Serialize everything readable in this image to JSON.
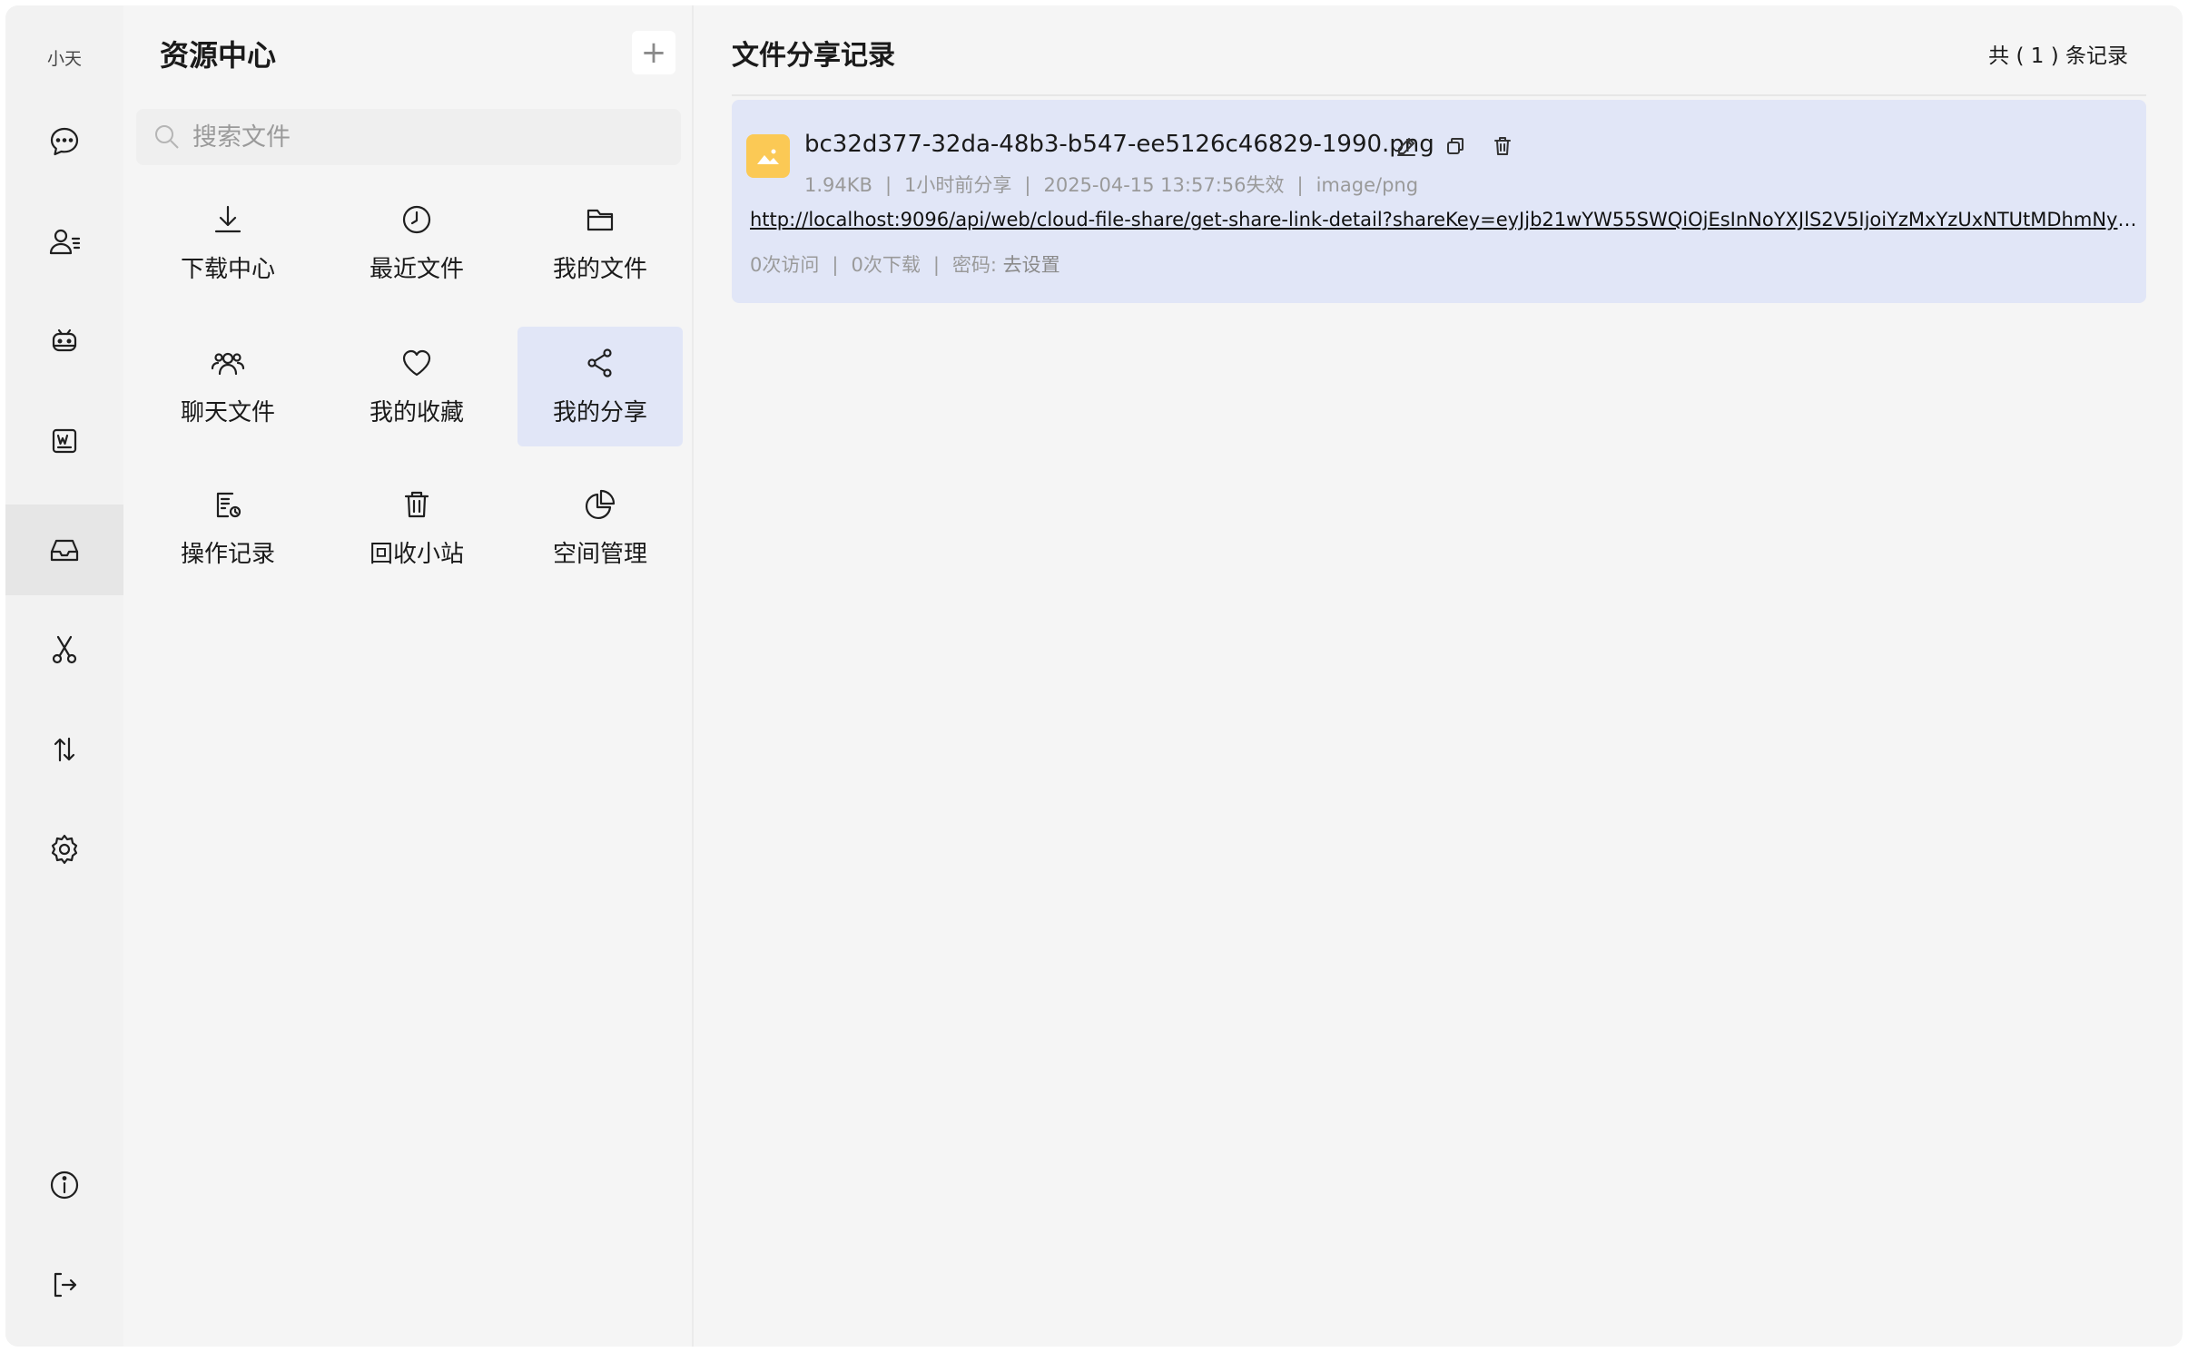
{
  "rail": {
    "user_name": "小天",
    "items": [
      {
        "icon": "chat-bubble-icon"
      },
      {
        "icon": "contacts-icon"
      },
      {
        "icon": "robot-icon"
      },
      {
        "icon": "word-document-icon"
      },
      {
        "icon": "inbox-tray-icon",
        "active": true
      },
      {
        "icon": "scissors-icon"
      },
      {
        "icon": "transfer-arrows-icon"
      },
      {
        "icon": "gear-icon"
      },
      {
        "icon": "info-icon"
      },
      {
        "icon": "logout-icon"
      }
    ]
  },
  "panel": {
    "title": "资源中心",
    "add_label": "+",
    "search_placeholder": "搜索文件",
    "grid": [
      {
        "label": "下载中心",
        "icon": "download-icon"
      },
      {
        "label": "最近文件",
        "icon": "clock-icon"
      },
      {
        "label": "我的文件",
        "icon": "folder-icon"
      },
      {
        "label": "聊天文件",
        "icon": "group-users-icon"
      },
      {
        "label": "我的收藏",
        "icon": "heart-icon"
      },
      {
        "label": "我的分享",
        "icon": "share-icon",
        "active": true
      },
      {
        "label": "操作记录",
        "icon": "record-log-icon"
      },
      {
        "label": "回收小站",
        "icon": "trash-icon"
      },
      {
        "label": "空间管理",
        "icon": "pie-chart-icon"
      }
    ]
  },
  "main": {
    "title": "文件分享记录",
    "record_count": "共 ( 1 ) 条记录",
    "share": {
      "file_name": "bc32d377-32da-48b3-b547-ee5126c46829-1990.png",
      "size": "1.94KB",
      "shared_ago": "1小时前分享",
      "expires": "2025-04-15 13:57:56失效",
      "mime": "image/png",
      "link": "http://localhost:9096/api/web/cloud-file-share/get-share-link-detail?shareKey=eyJjb21wYW55SWQiOjEsInNoYXJlS2V5IjoiYzMxYzUxNTUtMDhmNy00N...",
      "visits": "0次访问",
      "downloads": "0次下载",
      "password_label": "密码:",
      "password_action": "去设置"
    }
  },
  "colors": {
    "active_bg": "#e1e6f7",
    "thumb": "#fbc955"
  }
}
